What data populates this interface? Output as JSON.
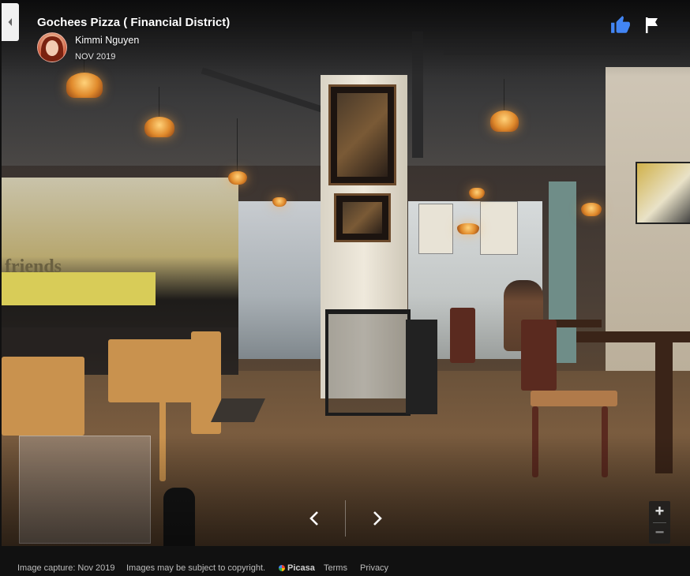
{
  "header": {
    "place_title": "Gochees Pizza ( Financial District)",
    "author_name": "Kimmi Nguyen",
    "capture_date": "NOV 2019"
  },
  "actions": {
    "back_icon": "chevron-left-icon",
    "like_icon": "thumbs-up-icon",
    "flag_icon": "flag-icon",
    "like_color": "#4285f4"
  },
  "scene": {
    "sign_text": "friends"
  },
  "navigation": {
    "prev_icon": "chevron-left-icon",
    "next_icon": "chevron-right-icon"
  },
  "zoom": {
    "zoom_in_label": "+",
    "zoom_out_label": "−"
  },
  "footer": {
    "image_capture": "Image capture: Nov 2019",
    "copyright": "Images may be subject to copyright.",
    "picasa": "Picasa",
    "terms": "Terms",
    "privacy": "Privacy"
  }
}
